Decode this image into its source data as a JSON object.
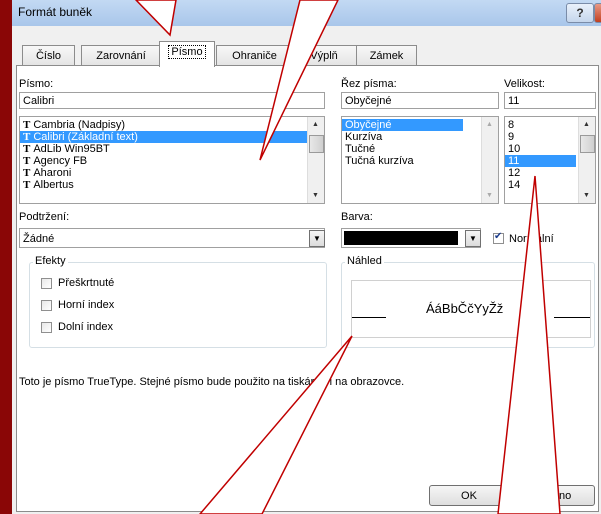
{
  "window": {
    "title": "Formát buněk",
    "help_label": "?",
    "close_label": "✕"
  },
  "tabs": [
    "Číslo",
    "Zarovnání",
    "Písmo",
    "Ohraniče",
    "Výplň",
    "Zámek"
  ],
  "font": {
    "label": "Písmo:",
    "value": "Calibri",
    "items": [
      "Cambria (Nadpisy)",
      "Calibri (Základní text)",
      "AdLib Win95BT",
      "Agency FB",
      "Aharoni",
      "Albertus"
    ],
    "selected_index": 1,
    "icon_glyph": "T"
  },
  "style": {
    "label": "Řez písma:",
    "value": "Obyčejné",
    "items": [
      "Obyčejné",
      "Kurzíva",
      "Tučné",
      "Tučná kurzíva"
    ],
    "selected_index": 0
  },
  "size": {
    "label": "Velikost:",
    "value": "11",
    "items": [
      "8",
      "9",
      "10",
      "11",
      "12",
      "14"
    ],
    "selected_index": 3
  },
  "underline": {
    "label": "Podtržení:",
    "value": "Žádné"
  },
  "color": {
    "label": "Barva:",
    "swatch": "#000000",
    "normal_label": "Normální",
    "normal_checked": true
  },
  "effects": {
    "title": "Efekty",
    "items": [
      {
        "label": "Přeškrtnuté",
        "checked": false
      },
      {
        "label": "Horní index",
        "checked": false
      },
      {
        "label": "Dolní index",
        "checked": false
      }
    ]
  },
  "preview": {
    "title": "Náhled",
    "sample": "ÁáBbČčYyŽž"
  },
  "info": "Toto je písmo TrueType. Stejné písmo bude použito na tiskárně i na obrazovce.",
  "buttons": {
    "ok": "OK",
    "cancel": "Storno"
  },
  "colors": {
    "frame": "#8a0606",
    "selection": "#3399ff",
    "callout_border": "#c00000"
  }
}
